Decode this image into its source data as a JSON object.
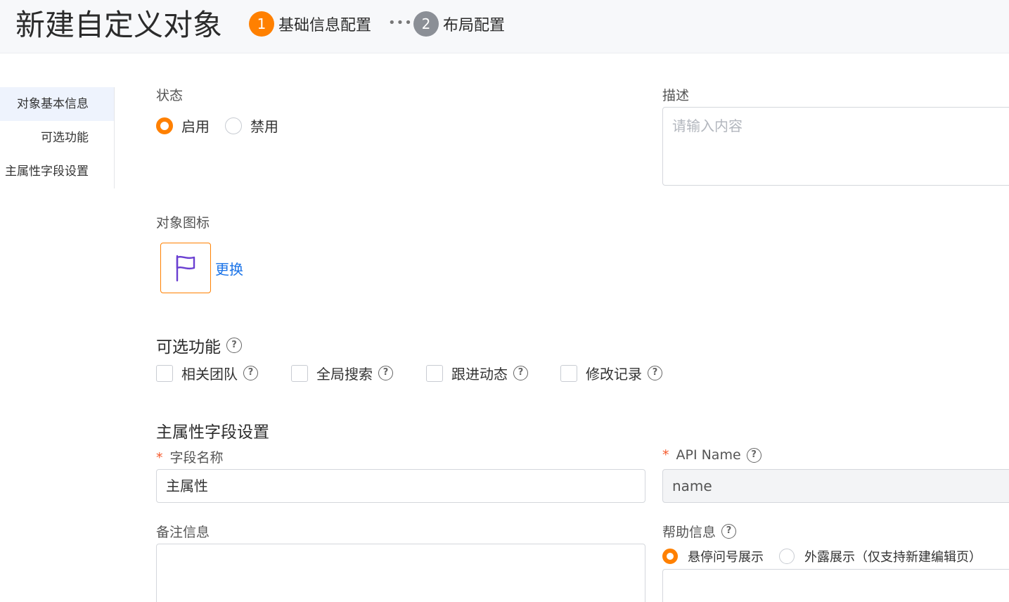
{
  "header": {
    "title": "新建自定义对象",
    "steps": [
      {
        "num": "1",
        "label": "基础信息配置"
      },
      {
        "num": "2",
        "label": "布局配置"
      }
    ],
    "separator": "•••"
  },
  "anchor_nav": {
    "items": [
      {
        "label": "对象基本信息",
        "active": true
      },
      {
        "label": "可选功能",
        "active": false
      },
      {
        "label": "主属性字段设置",
        "active": false
      }
    ]
  },
  "status": {
    "label": "状态",
    "options": [
      {
        "label": "启用",
        "checked": true
      },
      {
        "label": "禁用",
        "checked": false
      }
    ]
  },
  "description": {
    "label": "描述",
    "placeholder": "请输入内容",
    "value": ""
  },
  "object_icon": {
    "label": "对象图标",
    "icon": "flag-icon",
    "icon_color": "#6a3fd1",
    "change_link": "更换"
  },
  "optional_features": {
    "title": "可选功能",
    "options": [
      {
        "label": "相关团队",
        "checked": false
      },
      {
        "label": "全局搜索",
        "checked": false
      },
      {
        "label": "跟进动态",
        "checked": false
      },
      {
        "label": "修改记录",
        "checked": false
      }
    ]
  },
  "primary_field": {
    "title": "主属性字段设置",
    "field_name": {
      "required_mark": "*",
      "label": "字段名称",
      "value": "主属性"
    },
    "api_name": {
      "required_mark": "*",
      "label": "API Name",
      "value": "name"
    },
    "remark": {
      "label": "备注信息",
      "value": ""
    },
    "help": {
      "label": "帮助信息",
      "options": [
        {
          "label": "悬停问号展示",
          "checked": true
        },
        {
          "label": "外露展示（仅支持新建编辑页）",
          "checked": false
        }
      ]
    }
  },
  "colors": {
    "accent": "#ff8000",
    "link": "#1a73e8",
    "nav_active_bg": "#eef3fd"
  }
}
